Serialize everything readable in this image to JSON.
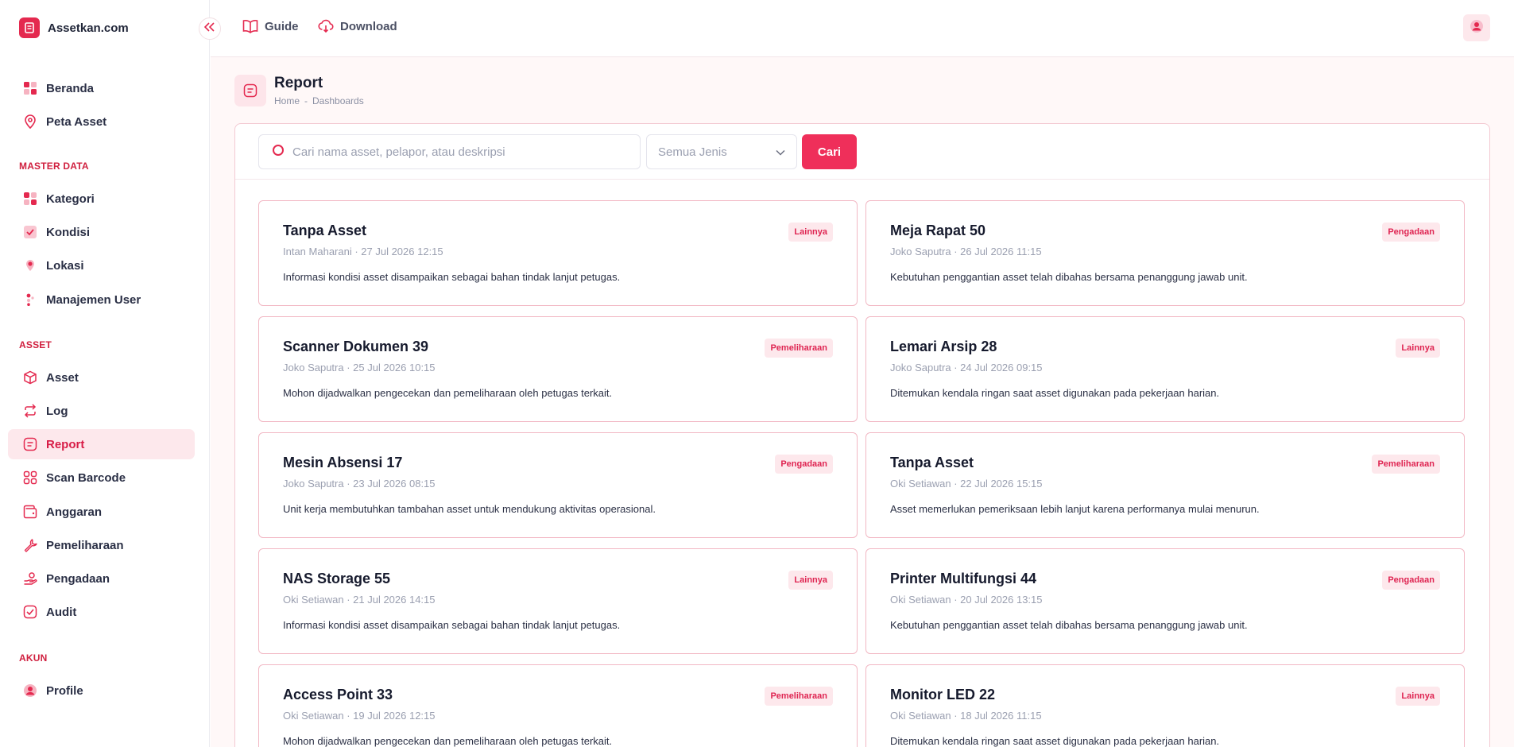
{
  "brand": {
    "name": "Assetkan.com"
  },
  "colors": {
    "accent": "#ef2f5a",
    "accent_soft": "#fde8ec",
    "section": "#d0203f"
  },
  "topbar": {
    "links": [
      {
        "label": "Guide",
        "icon": "book-open-icon"
      },
      {
        "label": "Download",
        "icon": "cloud-download-icon"
      }
    ]
  },
  "sidebar": {
    "items_top": [
      {
        "label": "Beranda",
        "icon": "grid-icon"
      },
      {
        "label": "Peta Asset",
        "icon": "map-pin-icon"
      }
    ],
    "master": {
      "title": "MASTER DATA",
      "items": [
        {
          "label": "Kategori",
          "icon": "grid-icon"
        },
        {
          "label": "Kondisi",
          "icon": "check-square-icon"
        },
        {
          "label": "Lokasi",
          "icon": "location-dot-icon"
        },
        {
          "label": "Manajemen User",
          "icon": "users-icon"
        }
      ]
    },
    "asset": {
      "title": "ASSET",
      "items": [
        {
          "label": "Asset",
          "icon": "box-icon"
        },
        {
          "label": "Log",
          "icon": "repeat-icon"
        },
        {
          "label": "Report",
          "icon": "report-icon",
          "active": true
        },
        {
          "label": "Scan Barcode",
          "icon": "scan-icon"
        },
        {
          "label": "Anggaran",
          "icon": "wallet-icon"
        },
        {
          "label": "Pemeliharaan",
          "icon": "wrench-icon"
        },
        {
          "label": "Pengadaan",
          "icon": "hand-coin-icon"
        },
        {
          "label": "Audit",
          "icon": "check-badge-icon"
        }
      ]
    },
    "akun": {
      "title": "AKUN",
      "items": [
        {
          "label": "Profile",
          "icon": "user-circle-icon"
        }
      ]
    }
  },
  "page": {
    "title": "Report",
    "breadcrumb": {
      "home": "Home",
      "sep": "-",
      "current": "Dashboards"
    }
  },
  "filter": {
    "search_placeholder": "Cari nama asset, pelapor, atau deskripsi",
    "search_value": "",
    "jenis_selected": "Semua Jenis",
    "submit_label": "Cari"
  },
  "reports": [
    {
      "title": "Tanpa Asset",
      "meta": "Intan Maharani · 27 Jul 2026 12:15",
      "desc": "Informasi kondisi asset disampaikan sebagai bahan tindak lanjut petugas.",
      "badge": "Lainnya"
    },
    {
      "title": "Meja Rapat 50",
      "meta": "Joko Saputra · 26 Jul 2026 11:15",
      "desc": "Kebutuhan penggantian asset telah dibahas bersama penanggung jawab unit.",
      "badge": "Pengadaan"
    },
    {
      "title": "Scanner Dokumen 39",
      "meta": "Joko Saputra · 25 Jul 2026 10:15",
      "desc": "Mohon dijadwalkan pengecekan dan pemeliharaan oleh petugas terkait.",
      "badge": "Pemeliharaan"
    },
    {
      "title": "Lemari Arsip 28",
      "meta": "Joko Saputra · 24 Jul 2026 09:15",
      "desc": "Ditemukan kendala ringan saat asset digunakan pada pekerjaan harian.",
      "badge": "Lainnya"
    },
    {
      "title": "Mesin Absensi 17",
      "meta": "Joko Saputra · 23 Jul 2026 08:15",
      "desc": "Unit kerja membutuhkan tambahan asset untuk mendukung aktivitas operasional.",
      "badge": "Pengadaan"
    },
    {
      "title": "Tanpa Asset",
      "meta": "Oki Setiawan · 22 Jul 2026 15:15",
      "desc": "Asset memerlukan pemeriksaan lebih lanjut karena performanya mulai menurun.",
      "badge": "Pemeliharaan"
    },
    {
      "title": "NAS Storage 55",
      "meta": "Oki Setiawan · 21 Jul 2026 14:15",
      "desc": "Informasi kondisi asset disampaikan sebagai bahan tindak lanjut petugas.",
      "badge": "Lainnya"
    },
    {
      "title": "Printer Multifungsi 44",
      "meta": "Oki Setiawan · 20 Jul 2026 13:15",
      "desc": "Kebutuhan penggantian asset telah dibahas bersama penanggung jawab unit.",
      "badge": "Pengadaan"
    },
    {
      "title": "Access Point 33",
      "meta": "Oki Setiawan · 19 Jul 2026 12:15",
      "desc": "Mohon dijadwalkan pengecekan dan pemeliharaan oleh petugas terkait.",
      "badge": "Pemeliharaan"
    },
    {
      "title": "Monitor LED 22",
      "meta": "Oki Setiawan · 18 Jul 2026 11:15",
      "desc": "Ditemukan kendala ringan saat asset digunakan pada pekerjaan harian.",
      "badge": "Lainnya"
    }
  ]
}
